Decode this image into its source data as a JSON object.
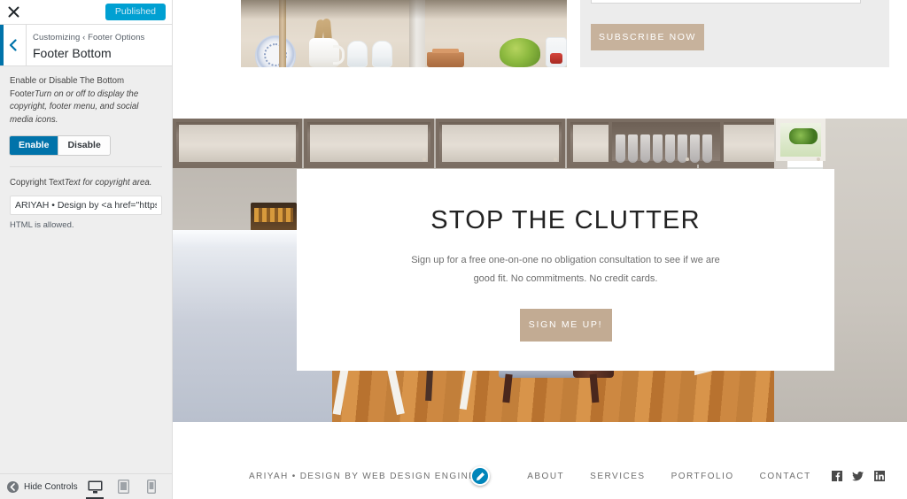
{
  "customizer": {
    "close_label": "Close",
    "publish_label": "Published",
    "back_label": "Back",
    "breadcrumb": "Customizing ‹ Footer Options",
    "panel_title": "Footer Bottom",
    "description_main": "Enable or Disable The Bottom Footer",
    "description_italic": "Turn on or off to display the copyright, footer menu, and social media icons.",
    "toggle": {
      "enable_label": "Enable",
      "disable_label": "Disable",
      "selected": "Enable"
    },
    "copyright_field": {
      "label": "Copyright Text",
      "label_italic": "Text for copyright area.",
      "value": "ARIYAH • Design by <a href=\"https://we",
      "help": "HTML is allowed."
    },
    "footer_bar": {
      "hide_controls_label": "Hide Controls",
      "devices": [
        {
          "name": "desktop",
          "active": true
        },
        {
          "name": "tablet",
          "active": false
        },
        {
          "name": "mobile",
          "active": false
        }
      ]
    },
    "colors": {
      "publish_bg": "#00a0d2",
      "accent_blue": "#0073aa",
      "sidebar_bg": "#eeeeee"
    }
  },
  "preview": {
    "subscribe": {
      "input_value": "",
      "button_label": "SUBSCRIBE NOW",
      "button_color": "#c7b29c"
    },
    "hero": {
      "title": "STOP THE CLUTTER",
      "subtitle": "Sign up for a free one-on-one no obligation consultation to see if we are good fit. No commitments. No credit cards.",
      "cta_label": "SIGN ME UP!",
      "cta_color": "#c2ab93"
    },
    "footer": {
      "copyright": "ARIYAH • DESIGN BY WEB DESIGN ENGINE",
      "edit_shortcut_title": "Click to edit this element.",
      "menu": [
        "ABOUT",
        "SERVICES",
        "PORTFOLIO",
        "CONTACT"
      ],
      "social": [
        "facebook",
        "twitter",
        "linkedin"
      ]
    }
  }
}
